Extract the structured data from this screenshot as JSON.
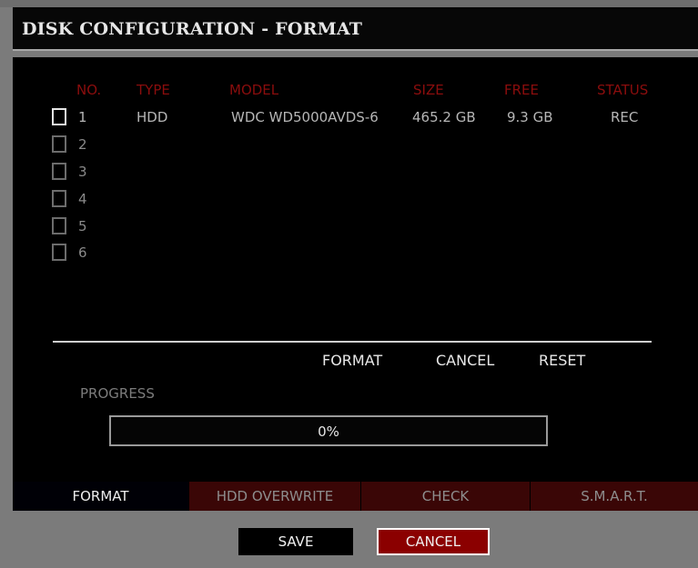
{
  "title": "DISK CONFIGURATION - FORMAT",
  "columns": {
    "no": "NO.",
    "type": "TYPE",
    "model": "MODEL",
    "size": "SIZE",
    "free": "FREE",
    "status": "STATUS"
  },
  "disks": [
    {
      "no": "1",
      "type": "HDD",
      "model": "WDC WD5000AVDS-6",
      "size": "465.2 GB",
      "free": "9.3 GB",
      "status": "REC"
    },
    {
      "no": "2",
      "type": "",
      "model": "",
      "size": "",
      "free": "",
      "status": ""
    },
    {
      "no": "3",
      "type": "",
      "model": "",
      "size": "",
      "free": "",
      "status": ""
    },
    {
      "no": "4",
      "type": "",
      "model": "",
      "size": "",
      "free": "",
      "status": ""
    },
    {
      "no": "5",
      "type": "",
      "model": "",
      "size": "",
      "free": "",
      "status": ""
    },
    {
      "no": "6",
      "type": "",
      "model": "",
      "size": "",
      "free": "",
      "status": ""
    }
  ],
  "actions": {
    "format": "FORMAT",
    "cancel": "CANCEL",
    "reset": "RESET"
  },
  "progress": {
    "label": "PROGRESS",
    "value_text": "0%",
    "percent": 0
  },
  "tabs": [
    {
      "label": "FORMAT",
      "active": true
    },
    {
      "label": "HDD OVERWRITE",
      "active": false
    },
    {
      "label": "CHECK",
      "active": false
    },
    {
      "label": "S.M.A.R.T.",
      "active": false
    }
  ],
  "buttons": {
    "save": "SAVE",
    "cancel": "CANCEL"
  },
  "colors": {
    "header_red": "#8b0d0d",
    "inactive_tab": "#3a0606",
    "active_tab": "#000006",
    "cancel_button": "#8b0000"
  }
}
